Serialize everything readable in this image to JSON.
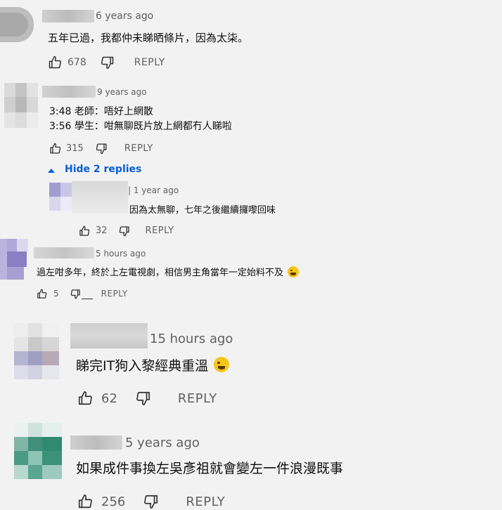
{
  "comments": [
    {
      "time": "6 years ago",
      "text": "五年已過，我都仲未睇晒條片，因為太柒。",
      "likes": "678",
      "reply": "REPLY"
    },
    {
      "time": "9 years ago",
      "text_line1": "3:48 老師：唔好上網散",
      "text_line2": "3:56 學生：咁無聊既片放上網都冇人睇啦",
      "likes": "315",
      "reply": "REPLY",
      "replies_toggle": "Hide 2 replies"
    },
    {
      "time": "1 year ago",
      "text": "因為太無聊，七年之後繼續攞嚟回味",
      "likes": "32",
      "reply": "REPLY"
    },
    {
      "time": "5 hours ago",
      "text": "過左咁多年，終於上左電視劇，相信男主角當年一定始料不及",
      "likes": "5",
      "reply": "REPLY"
    },
    {
      "time": "15 hours ago",
      "text": "睇完IT狗入黎經典重溫",
      "likes": "62",
      "reply": "REPLY"
    },
    {
      "time": "5 years ago",
      "text": "如果成件事換左吳彥祖就會變左一件浪漫既事",
      "likes": "256",
      "reply": "REPLY"
    }
  ],
  "icons": {
    "like": "thumbs-up-icon",
    "dislike": "thumbs-down-icon",
    "toggle": "caret-up-icon",
    "emoji_joy": "face-with-tears-of-joy-emoji",
    "emoji_rofl": "rolling-on-floor-laughing-emoji"
  },
  "colors": {
    "background": "#f2f2f2",
    "text": "#0f0f0f",
    "secondary": "#606060",
    "link_blue": "#065fd4"
  }
}
